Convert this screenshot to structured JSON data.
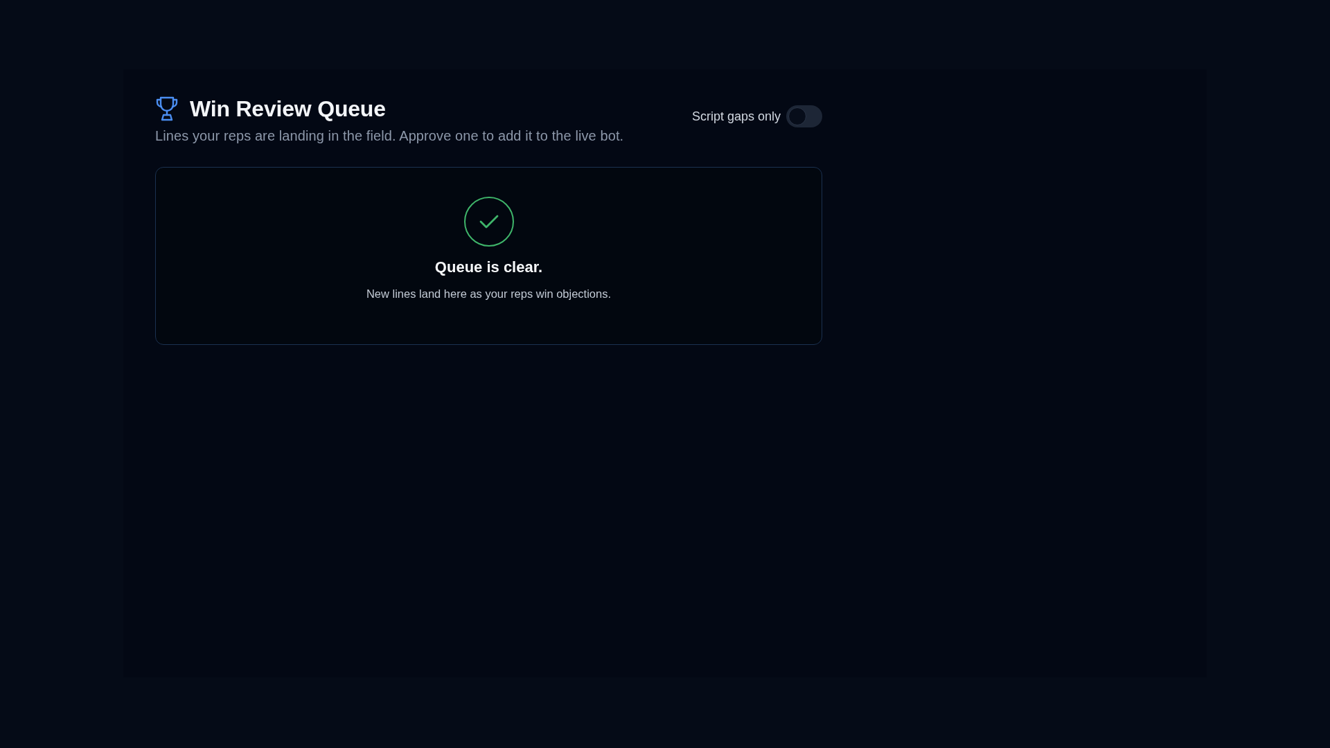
{
  "header": {
    "title": "Win Review Queue",
    "subtitle": "Lines your reps are landing in the field. Approve one to add it to the live bot."
  },
  "filter_toggle": {
    "label": "Script gaps only",
    "on": false
  },
  "empty_state": {
    "title": "Queue is clear.",
    "message": "New lines land here as your reps win objections."
  }
}
